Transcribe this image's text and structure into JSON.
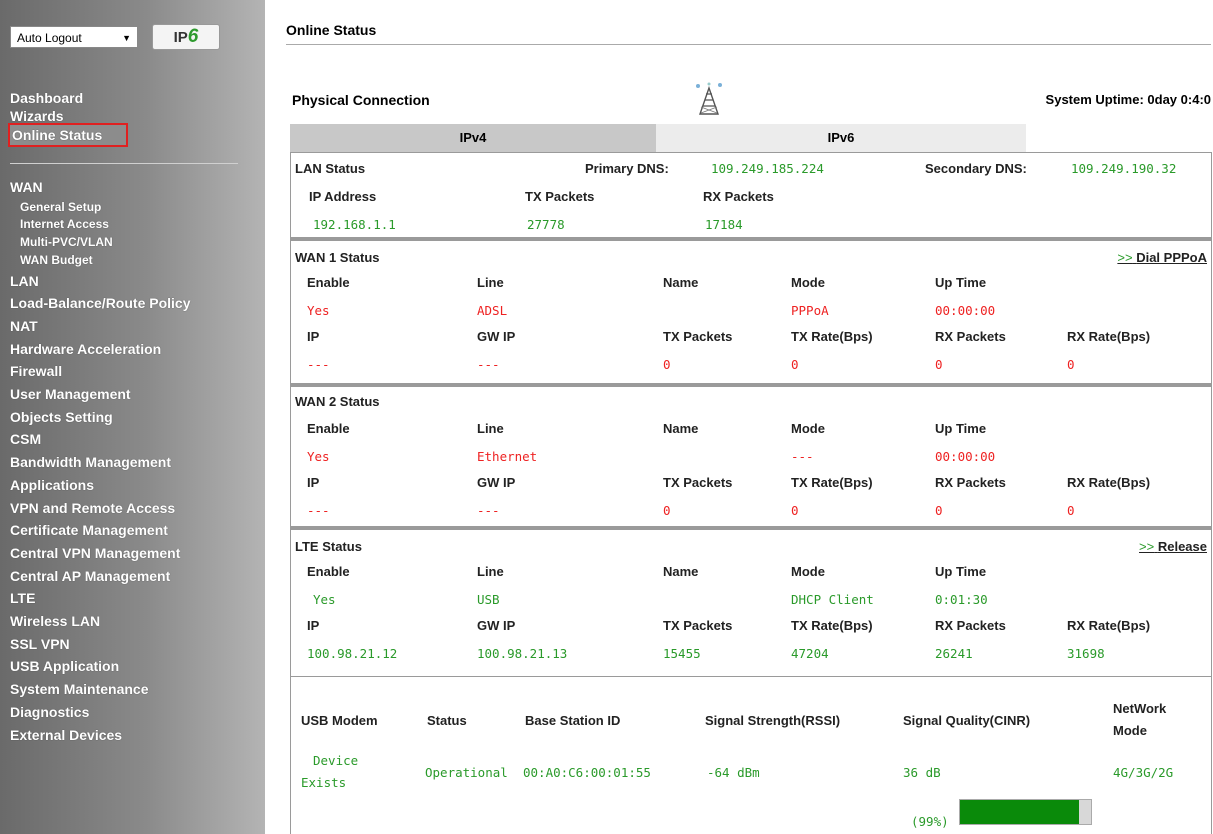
{
  "sidebar": {
    "auto_logout": "Auto Logout",
    "ipv6_ip": "IP",
    "ipv6_six": "6",
    "menu_top": [
      "Dashboard",
      "Wizards"
    ],
    "active_item": "Online Status",
    "menu": [
      {
        "label": "WAN",
        "sub": false
      },
      {
        "label": "General Setup",
        "sub": true
      },
      {
        "label": "Internet Access",
        "sub": true
      },
      {
        "label": "Multi-PVC/VLAN",
        "sub": true
      },
      {
        "label": "WAN Budget",
        "sub": true
      },
      {
        "label": "LAN",
        "sub": false
      },
      {
        "label": "Load-Balance/Route Policy",
        "sub": false
      },
      {
        "label": "NAT",
        "sub": false
      },
      {
        "label": "Hardware Acceleration",
        "sub": false
      },
      {
        "label": "Firewall",
        "sub": false
      },
      {
        "label": "User Management",
        "sub": false
      },
      {
        "label": "Objects Setting",
        "sub": false
      },
      {
        "label": "CSM",
        "sub": false
      },
      {
        "label": "Bandwidth Management",
        "sub": false
      },
      {
        "label": "Applications",
        "sub": false
      },
      {
        "label": "VPN and Remote Access",
        "sub": false
      },
      {
        "label": "Certificate Management",
        "sub": false
      },
      {
        "label": "Central VPN Management",
        "sub": false
      },
      {
        "label": "Central AP Management",
        "sub": false
      },
      {
        "label": "LTE",
        "sub": false
      },
      {
        "label": "Wireless LAN",
        "sub": false
      },
      {
        "label": "SSL VPN",
        "sub": false
      },
      {
        "label": "USB Application",
        "sub": false
      },
      {
        "label": "System Maintenance",
        "sub": false
      },
      {
        "label": "Diagnostics",
        "sub": false
      },
      {
        "label": "External Devices",
        "sub": false
      }
    ]
  },
  "main": {
    "title": "Online Status",
    "physical": "Physical Connection",
    "uptime": "System Uptime: 0day 0:4:0",
    "tabs": [
      "IPv4",
      "IPv6"
    ],
    "lan": {
      "title": "LAN Status",
      "primary_dns_label": "Primary DNS:",
      "primary_dns": "109.249.185.224",
      "secondary_dns_label": "Secondary DNS:",
      "secondary_dns": "109.249.190.32",
      "headers": [
        "IP Address",
        "TX Packets",
        "RX Packets"
      ],
      "values": [
        "192.168.1.1",
        "27778",
        "17184"
      ]
    },
    "wan_headers_1": [
      "Enable",
      "Line",
      "Name",
      "Mode",
      "Up Time"
    ],
    "wan_headers_2": [
      "IP",
      "GW IP",
      "TX Packets",
      "TX Rate(Bps)",
      "RX Packets",
      "RX Rate(Bps)"
    ],
    "wan1": {
      "title": "WAN 1 Status",
      "link_arrow": ">>",
      "link": "Dial PPPoA",
      "row1": [
        "Yes",
        "ADSL",
        "",
        "PPPoA",
        "00:00:00"
      ],
      "row2": [
        "---",
        "---",
        "0",
        "0",
        "0",
        "0"
      ]
    },
    "wan2": {
      "title": "WAN 2 Status",
      "row1": [
        "Yes",
        "Ethernet",
        "",
        "---",
        "00:00:00"
      ],
      "row2": [
        "---",
        "---",
        "0",
        "0",
        "0",
        "0"
      ]
    },
    "lte": {
      "title": "LTE Status",
      "link_arrow": ">>",
      "link": "Release",
      "row1": [
        "Yes",
        "USB",
        "",
        "DHCP Client",
        "0:01:30"
      ],
      "row2": [
        "100.98.21.12",
        "100.98.21.13",
        "15455",
        "47204",
        "26241",
        "31698"
      ]
    },
    "usb": {
      "headers": [
        "USB Modem",
        "Status",
        "Base Station ID",
        "Signal Strength(RSSI)",
        "Signal Quality(CINR)",
        "NetWork",
        "Mode"
      ],
      "device": "Device",
      "exists": "Exists",
      "status": "Operational",
      "base_station": "00:A0:C6:00:01:55",
      "rssi": "-64 dBm",
      "cinr": "36 dB",
      "network_mode": "4G/3G/2G",
      "signal_pct_label": "(99%)",
      "signal_pct": 0.99
    }
  }
}
